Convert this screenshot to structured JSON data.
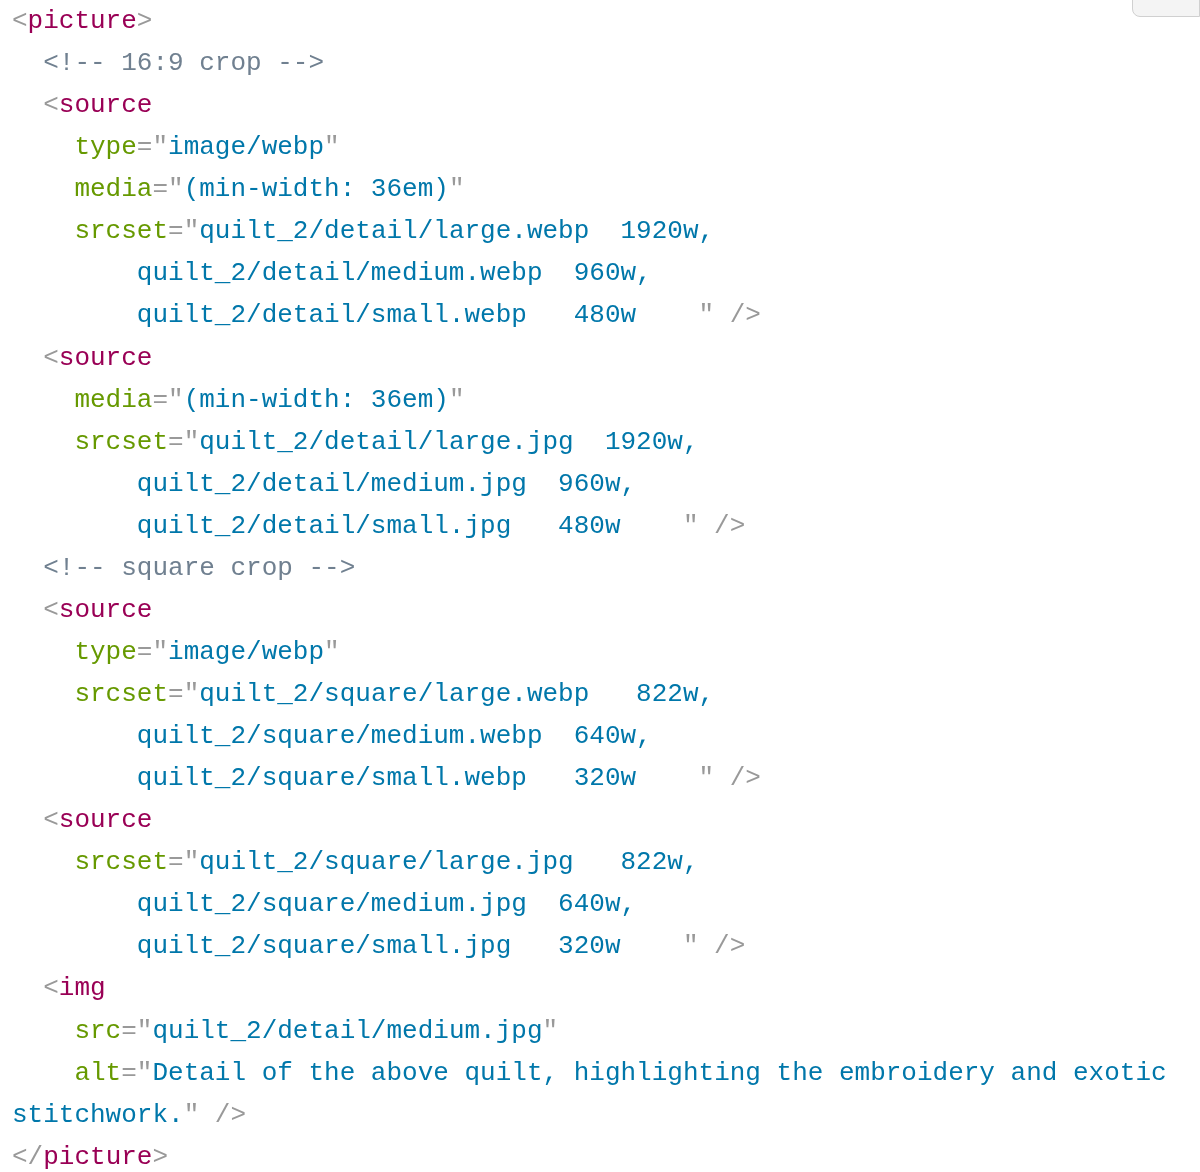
{
  "code_lines": [
    {
      "kind": "root",
      "tokens": [
        {
          "kind": "punct",
          "text": "<"
        },
        {
          "kind": "tag",
          "text": "picture"
        },
        {
          "kind": "punct",
          "text": ">"
        }
      ]
    },
    {
      "kind": "child",
      "tokens": [
        {
          "kind": "comment",
          "text": "<!-- 16:9 crop -->"
        }
      ]
    },
    {
      "kind": "child",
      "tokens": [
        {
          "kind": "punct",
          "text": "<"
        },
        {
          "kind": "tag",
          "text": "source"
        }
      ]
    },
    {
      "kind": "attribute",
      "tokens": [
        {
          "kind": "attr",
          "text": "type"
        },
        {
          "kind": "punct",
          "text": "=\""
        },
        {
          "kind": "string",
          "text": "image/webp"
        },
        {
          "kind": "punct",
          "text": "\""
        }
      ]
    },
    {
      "kind": "attribute",
      "tokens": [
        {
          "kind": "attr",
          "text": "media"
        },
        {
          "kind": "punct",
          "text": "=\""
        },
        {
          "kind": "string",
          "text": "(min-width: 36em)"
        },
        {
          "kind": "punct",
          "text": "\""
        }
      ]
    },
    {
      "kind": "attribute",
      "tokens": [
        {
          "kind": "attr",
          "text": "srcset"
        },
        {
          "kind": "punct",
          "text": "=\""
        },
        {
          "kind": "string",
          "text": "quilt_2/detail/large.webp  1920w,"
        }
      ]
    },
    {
      "kind": "continuation",
      "tokens": [
        {
          "kind": "string",
          "text": "quilt_2/detail/medium.webp  960w,"
        }
      ]
    },
    {
      "kind": "continuation",
      "tokens": [
        {
          "kind": "string",
          "text": "quilt_2/detail/small.webp   480w    "
        },
        {
          "kind": "punct",
          "text": "\" />"
        }
      ]
    },
    {
      "kind": "child",
      "tokens": [
        {
          "kind": "punct",
          "text": "<"
        },
        {
          "kind": "tag",
          "text": "source"
        }
      ]
    },
    {
      "kind": "attribute",
      "tokens": [
        {
          "kind": "attr",
          "text": "media"
        },
        {
          "kind": "punct",
          "text": "=\""
        },
        {
          "kind": "string",
          "text": "(min-width: 36em)"
        },
        {
          "kind": "punct",
          "text": "\""
        }
      ]
    },
    {
      "kind": "attribute",
      "tokens": [
        {
          "kind": "attr",
          "text": "srcset"
        },
        {
          "kind": "punct",
          "text": "=\""
        },
        {
          "kind": "string",
          "text": "quilt_2/detail/large.jpg  1920w,"
        }
      ]
    },
    {
      "kind": "continuation",
      "tokens": [
        {
          "kind": "string",
          "text": "quilt_2/detail/medium.jpg  960w,"
        }
      ]
    },
    {
      "kind": "continuation",
      "tokens": [
        {
          "kind": "string",
          "text": "quilt_2/detail/small.jpg   480w    "
        },
        {
          "kind": "punct",
          "text": "\" />"
        }
      ]
    },
    {
      "kind": "child",
      "tokens": [
        {
          "kind": "comment",
          "text": "<!-- square crop -->"
        }
      ]
    },
    {
      "kind": "child",
      "tokens": [
        {
          "kind": "punct",
          "text": "<"
        },
        {
          "kind": "tag",
          "text": "source"
        }
      ]
    },
    {
      "kind": "attribute",
      "tokens": [
        {
          "kind": "attr",
          "text": "type"
        },
        {
          "kind": "punct",
          "text": "=\""
        },
        {
          "kind": "string",
          "text": "image/webp"
        },
        {
          "kind": "punct",
          "text": "\""
        }
      ]
    },
    {
      "kind": "attribute",
      "tokens": [
        {
          "kind": "attr",
          "text": "srcset"
        },
        {
          "kind": "punct",
          "text": "=\""
        },
        {
          "kind": "string",
          "text": "quilt_2/square/large.webp   822w,"
        }
      ]
    },
    {
      "kind": "continuation",
      "tokens": [
        {
          "kind": "string",
          "text": "quilt_2/square/medium.webp  640w,"
        }
      ]
    },
    {
      "kind": "continuation",
      "tokens": [
        {
          "kind": "string",
          "text": "quilt_2/square/small.webp   320w    "
        },
        {
          "kind": "punct",
          "text": "\" />"
        }
      ]
    },
    {
      "kind": "child",
      "tokens": [
        {
          "kind": "punct",
          "text": "<"
        },
        {
          "kind": "tag",
          "text": "source"
        }
      ]
    },
    {
      "kind": "attribute",
      "tokens": [
        {
          "kind": "attr",
          "text": "srcset"
        },
        {
          "kind": "punct",
          "text": "=\""
        },
        {
          "kind": "string",
          "text": "quilt_2/square/large.jpg   822w,"
        }
      ]
    },
    {
      "kind": "continuation",
      "tokens": [
        {
          "kind": "string",
          "text": "quilt_2/square/medium.jpg  640w,"
        }
      ]
    },
    {
      "kind": "continuation",
      "tokens": [
        {
          "kind": "string",
          "text": "quilt_2/square/small.jpg   320w    "
        },
        {
          "kind": "punct",
          "text": "\" />"
        }
      ]
    },
    {
      "kind": "child",
      "tokens": [
        {
          "kind": "punct",
          "text": "<"
        },
        {
          "kind": "tag",
          "text": "img"
        }
      ]
    },
    {
      "kind": "attribute",
      "tokens": [
        {
          "kind": "attr",
          "text": "src"
        },
        {
          "kind": "punct",
          "text": "=\""
        },
        {
          "kind": "string",
          "text": "quilt_2/detail/medium.jpg"
        },
        {
          "kind": "punct",
          "text": "\""
        }
      ]
    },
    {
      "kind": "attribute",
      "tokens": [
        {
          "kind": "attr",
          "text": "alt"
        },
        {
          "kind": "punct",
          "text": "=\""
        },
        {
          "kind": "string",
          "text": "Detail of the above quilt, highlighting the embroidery and exotic stitchwork."
        },
        {
          "kind": "punct",
          "text": "\" />"
        }
      ]
    },
    {
      "kind": "root",
      "tokens": [
        {
          "kind": "punct",
          "text": "</"
        },
        {
          "kind": "tag",
          "text": "picture"
        },
        {
          "kind": "punct",
          "text": ">"
        }
      ]
    }
  ]
}
